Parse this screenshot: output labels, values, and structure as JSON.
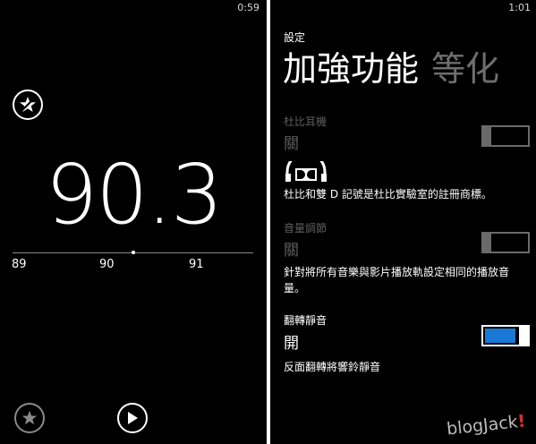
{
  "radio": {
    "clock": "0:59",
    "frequency": "90.3",
    "ticks": [
      "89",
      "90",
      "91"
    ]
  },
  "settings": {
    "clock": "1:01",
    "section": "設定",
    "title": "加強功能",
    "next_pivot": "等化",
    "dolby_headphones": {
      "label": "杜比耳機",
      "state": "關",
      "enabled": false
    },
    "dolby_trademark": "杜比和雙 D 記號是杜比實驗室的註冊商標。",
    "volume_leveling": {
      "label": "音量調節",
      "state": "關",
      "enabled": false,
      "description": "針對將所有音樂與影片播放軌設定相同的播放音量。"
    },
    "flip_to_mute": {
      "label": "翻轉靜音",
      "state": "開",
      "enabled": true,
      "description": "反面翻轉將響鈴靜音"
    },
    "accent_color": "#1a78d6"
  },
  "watermark": {
    "text": "blogJack",
    "mark": "!"
  }
}
